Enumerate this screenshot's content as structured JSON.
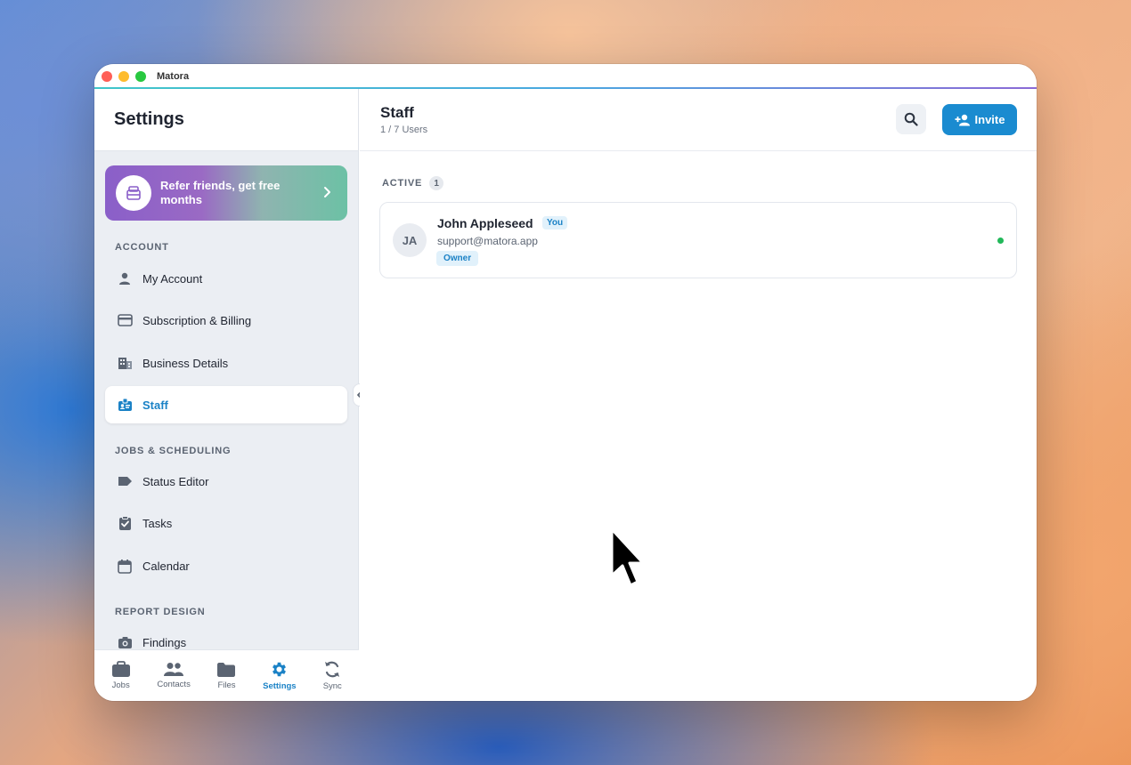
{
  "window": {
    "app_title": "Matora"
  },
  "sidebar": {
    "title": "Settings",
    "promo": {
      "text": "Refer friends, get free months",
      "icon": "gift-card-icon"
    },
    "sections": [
      {
        "label": "ACCOUNT"
      },
      {
        "label": "JOBS & SCHEDULING"
      },
      {
        "label": "REPORT DESIGN"
      }
    ],
    "items": [
      {
        "label": "My Account",
        "icon": "person-icon"
      },
      {
        "label": "Subscription & Billing",
        "icon": "credit-card-icon"
      },
      {
        "label": "Business Details",
        "icon": "building-icon"
      },
      {
        "label": "Staff",
        "icon": "badge-icon",
        "active": true
      },
      {
        "label": "Status Editor",
        "icon": "tag-icon"
      },
      {
        "label": "Tasks",
        "icon": "clipboard-check-icon"
      },
      {
        "label": "Calendar",
        "icon": "calendar-icon"
      },
      {
        "label": "Findings",
        "icon": "camera-icon"
      }
    ]
  },
  "tabbar": {
    "tabs": [
      {
        "label": "Jobs",
        "icon": "briefcase-icon"
      },
      {
        "label": "Contacts",
        "icon": "people-icon"
      },
      {
        "label": "Files",
        "icon": "folder-icon"
      },
      {
        "label": "Settings",
        "icon": "gear-icon",
        "active": true
      },
      {
        "label": "Sync",
        "icon": "sync-icon"
      }
    ]
  },
  "main": {
    "title": "Staff",
    "subtitle": "1 / 7 Users",
    "invite_label": "Invite",
    "active_label": "ACTIVE",
    "active_count": "1",
    "users": [
      {
        "initials": "JA",
        "name": "John Appleseed",
        "you_badge": "You",
        "email": "support@matora.app",
        "role": "Owner",
        "status": "online"
      }
    ]
  },
  "colors": {
    "accent": "#1a8bd0",
    "online": "#22b85a",
    "promo_start": "#8a5fc9",
    "promo_end": "#6cc1a5"
  }
}
